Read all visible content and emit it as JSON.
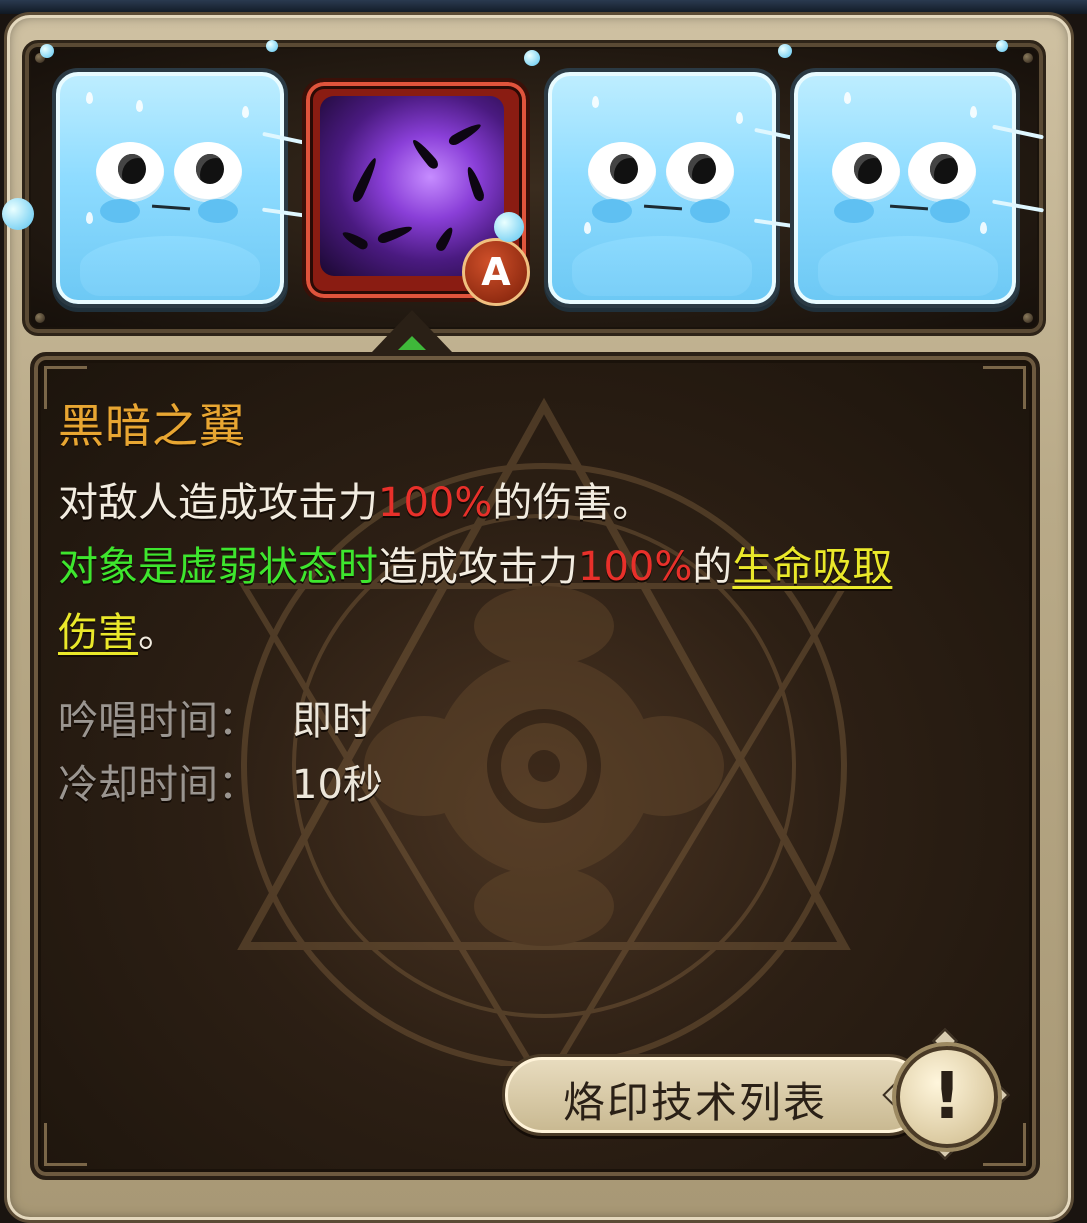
{
  "skill": {
    "name": "黑暗之翼",
    "grade_badge": "A",
    "line1": {
      "before": "对敌人造成攻击力",
      "value": "100%",
      "after": "的伤害。"
    },
    "line2": {
      "condition": "对象是虚弱状态时",
      "mid": "造成攻击力",
      "value": "100%",
      "of": "的",
      "keyword1": "生命吸取"
    },
    "line3": {
      "keyword2": "伤害",
      "end": "。"
    }
  },
  "stats": {
    "cast_label": "吟唱时间：",
    "cast_value": "即时",
    "cooldown_label": "冷却时间：",
    "cooldown_value": "10秒"
  },
  "buttons": {
    "rune_list": "烙印技术列表",
    "info_glyph": "!"
  },
  "colors": {
    "skill_name": "#e8a632",
    "highlight_red": "#e8302a",
    "highlight_green": "#3ee62e",
    "highlight_yellow": "#eae82a"
  },
  "icons": {
    "slot1": "slime-icon",
    "slot2": "dark-wings-skill-icon",
    "slot3": "slime-icon",
    "slot4": "slime-icon",
    "info": "exclamation-icon"
  }
}
